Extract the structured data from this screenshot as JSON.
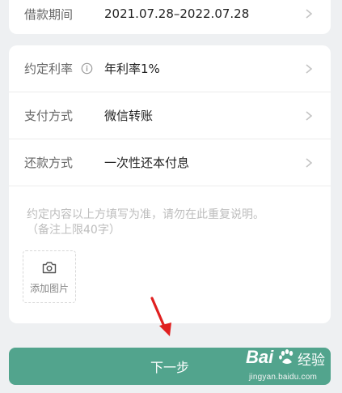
{
  "loan_period": {
    "label": "借款期间",
    "value": "2021.07.28–2022.07.28"
  },
  "rows": [
    {
      "label": "约定利率",
      "value": "年利率1%",
      "icon": "info-icon"
    },
    {
      "label": "支付方式",
      "value": "微信转账"
    },
    {
      "label": "还款方式",
      "value": "一次性还本付息"
    }
  ],
  "notes": {
    "placeholder_line1": "约定内容以上方填写为准，请勿在此重复说明。",
    "placeholder_line2": "（备注上限40字）"
  },
  "add_photo": {
    "label": "添加图片",
    "icon": "camera-icon"
  },
  "next_button": {
    "label": "下一步"
  },
  "watermark": {
    "brand": "Bai",
    "brand_suffix": "经验",
    "url": "jingyan.baidu.com"
  },
  "colors": {
    "accent": "#52a48d",
    "background": "#eef0f2",
    "card": "#ffffff",
    "arrow": "#e02020"
  }
}
